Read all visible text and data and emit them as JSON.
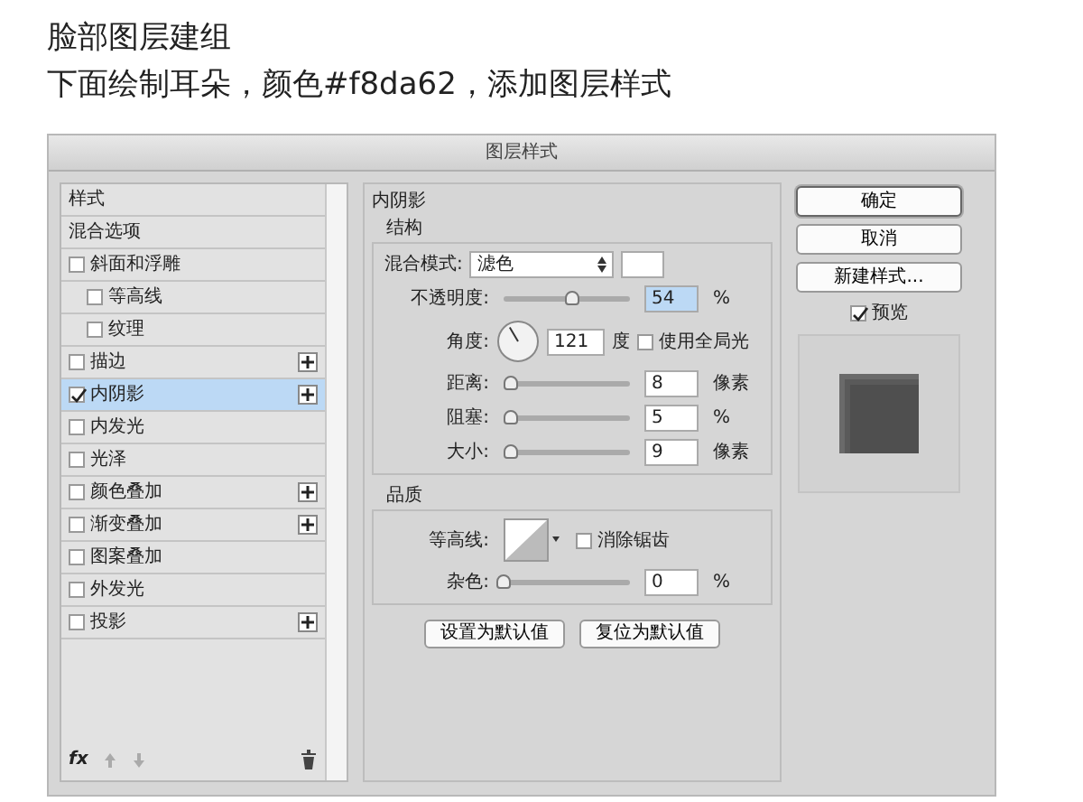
{
  "headings": [
    "脸部图层建组",
    "下面绘制耳朵，颜色#f8da62，添加图层样式"
  ],
  "dialog": {
    "title": "图层样式",
    "styles": [
      {
        "label": "样式",
        "kind": "header",
        "selected": false
      },
      {
        "label": "混合选项",
        "kind": "header",
        "selected": false
      },
      {
        "label": "斜面和浮雕",
        "kind": "option",
        "checked": false,
        "selected": false,
        "children": [
          {
            "label": "等高线",
            "kind": "option",
            "checked": false,
            "selected": false
          },
          {
            "label": "纹理",
            "kind": "option",
            "checked": false,
            "selected": false
          }
        ]
      },
      {
        "label": "描边",
        "kind": "option",
        "checked": false,
        "selected": false,
        "add": true
      },
      {
        "label": "内阴影",
        "kind": "option",
        "checked": true,
        "selected": true,
        "add": true
      },
      {
        "label": "内发光",
        "kind": "option",
        "checked": false,
        "selected": false
      },
      {
        "label": "光泽",
        "kind": "option",
        "checked": false,
        "selected": false
      },
      {
        "label": "颜色叠加",
        "kind": "option",
        "checked": false,
        "selected": false,
        "add": true
      },
      {
        "label": "渐变叠加",
        "kind": "option",
        "checked": false,
        "selected": false,
        "add": true
      },
      {
        "label": "图案叠加",
        "kind": "option",
        "checked": false,
        "selected": false
      },
      {
        "label": "外发光",
        "kind": "option",
        "checked": false,
        "selected": false
      },
      {
        "label": "投影",
        "kind": "option",
        "checked": false,
        "selected": false,
        "add": true
      }
    ],
    "fx": "fx",
    "panel": {
      "title": "内阴影",
      "structure": {
        "title": "结构",
        "blend": {
          "label": "混合模式:",
          "value": "滤色",
          "color": "#ffffff"
        },
        "rows": [
          {
            "kind": "slider",
            "label": "不透明度:",
            "value": "54",
            "unit": "%",
            "level": 0.54,
            "selected": true
          },
          {
            "kind": "angle",
            "label": "角度:",
            "value": "121",
            "unit": "度",
            "global_label": "使用全局光",
            "global_checked": false
          },
          {
            "kind": "slider",
            "label": "距离:",
            "value": "8",
            "unit": "像素",
            "level": 0.05,
            "selected": false
          },
          {
            "kind": "slider",
            "label": "阻塞:",
            "value": "5",
            "unit": "%",
            "level": 0.05,
            "selected": false
          },
          {
            "kind": "slider",
            "label": "大小:",
            "value": "9",
            "unit": "像素",
            "level": 0.05,
            "selected": false
          }
        ]
      },
      "quality": {
        "title": "品质",
        "contour_label": "等高线:",
        "antialias_label": "消除锯齿",
        "antialias_checked": false,
        "noise": {
          "label": "杂色:",
          "value": "0",
          "unit": "%",
          "level": 0
        }
      },
      "buttons": [
        "设置为默认值",
        "复位为默认值"
      ]
    },
    "actions": [
      {
        "label": "确定",
        "default": true
      },
      {
        "label": "取消",
        "default": false
      },
      {
        "label": "新建样式...",
        "default": false
      }
    ],
    "preview": {
      "label": "预览",
      "checked": true
    }
  }
}
